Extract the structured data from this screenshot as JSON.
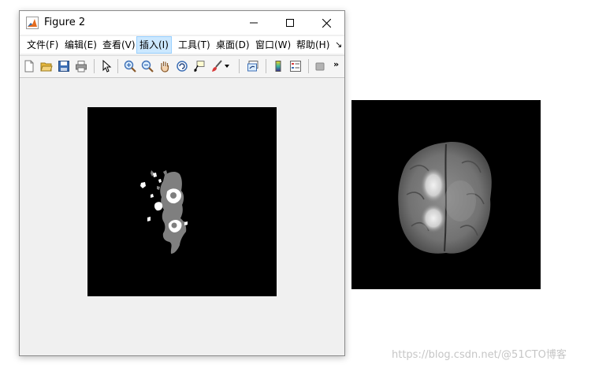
{
  "window": {
    "title": "Figure 2"
  },
  "menubar": {
    "items": [
      {
        "label": "文件(F)"
      },
      {
        "label": "编辑(E)"
      },
      {
        "label": "查看(V)"
      },
      {
        "label": "插入(I)"
      },
      {
        "label": "工具(T)"
      },
      {
        "label": "桌面(D)"
      },
      {
        "label": "窗口(W)"
      },
      {
        "label": "帮助(H)"
      }
    ],
    "overflow_glyph": "↘"
  },
  "toolbar": {
    "buttons": [
      "new-figure-icon",
      "open-file-icon",
      "save-icon",
      "print-icon",
      "edit-plot-icon",
      "zoom-in-icon",
      "zoom-out-icon",
      "pan-icon",
      "rotate-3d-icon",
      "data-cursor-icon",
      "brush-icon",
      "link-plot-icon",
      "colorbar-icon",
      "legend-icon",
      "property-inspector-icon"
    ],
    "overflow_glyph": "»"
  },
  "figure": {
    "segmentation_axes": "segmentation mask",
    "mri_axes": "brain MRI slice"
  },
  "watermark": "https://blog.csdn.net/@51CTO博客",
  "colors": {
    "axes_background": "#000000",
    "mask_gray": "#7f7f7f",
    "mask_white": "#ffffff",
    "window_background": "#f0f0f0",
    "active_menu": "#cce8ff"
  }
}
